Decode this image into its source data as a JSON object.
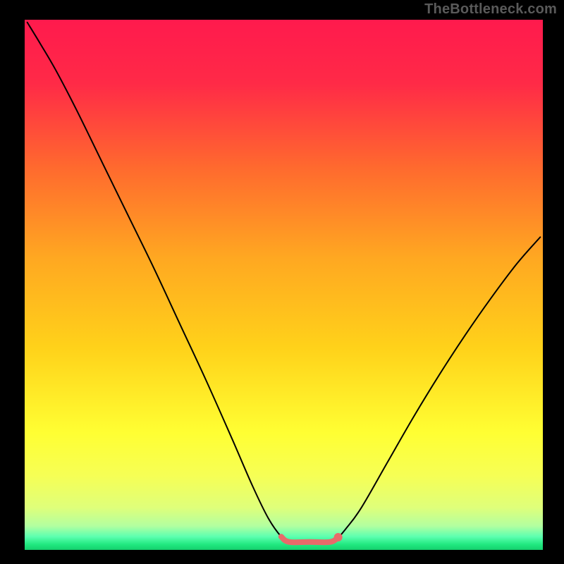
{
  "watermark": "TheBottleneck.com",
  "chart_data": {
    "type": "line",
    "title": "",
    "xlabel": "",
    "ylabel": "",
    "xlim": [
      0,
      100
    ],
    "ylim": [
      0,
      100
    ],
    "background_gradient": {
      "stops": [
        {
          "offset": 0.0,
          "color": "#ff1a4d"
        },
        {
          "offset": 0.12,
          "color": "#ff2a47"
        },
        {
          "offset": 0.28,
          "color": "#ff6a2e"
        },
        {
          "offset": 0.45,
          "color": "#ffa821"
        },
        {
          "offset": 0.62,
          "color": "#ffd21a"
        },
        {
          "offset": 0.78,
          "color": "#ffff33"
        },
        {
          "offset": 0.86,
          "color": "#f6ff55"
        },
        {
          "offset": 0.92,
          "color": "#dfff7a"
        },
        {
          "offset": 0.955,
          "color": "#b2ffa0"
        },
        {
          "offset": 0.975,
          "color": "#5cffb0"
        },
        {
          "offset": 0.99,
          "color": "#20e87f"
        },
        {
          "offset": 1.0,
          "color": "#15cf6d"
        }
      ]
    },
    "series": [
      {
        "name": "bottleneck-curve",
        "color": "#000000",
        "stroke_width": 2,
        "data": [
          {
            "x": 0.5,
            "y": 99.5
          },
          {
            "x": 3,
            "y": 95.5
          },
          {
            "x": 6,
            "y": 90.5
          },
          {
            "x": 10,
            "y": 83.0
          },
          {
            "x": 15,
            "y": 73.0
          },
          {
            "x": 20,
            "y": 63.0
          },
          {
            "x": 25,
            "y": 53.0
          },
          {
            "x": 30,
            "y": 42.5
          },
          {
            "x": 35,
            "y": 32.0
          },
          {
            "x": 40,
            "y": 21.0
          },
          {
            "x": 44,
            "y": 12.0
          },
          {
            "x": 47,
            "y": 6.0
          },
          {
            "x": 49.5,
            "y": 2.5
          },
          {
            "x": 51,
            "y": 1.5
          },
          {
            "x": 55,
            "y": 1.5
          },
          {
            "x": 59,
            "y": 1.5
          },
          {
            "x": 60.5,
            "y": 2.4
          },
          {
            "x": 62,
            "y": 4.0
          },
          {
            "x": 65,
            "y": 8.0
          },
          {
            "x": 70,
            "y": 16.5
          },
          {
            "x": 75,
            "y": 25.0
          },
          {
            "x": 80,
            "y": 33.0
          },
          {
            "x": 85,
            "y": 40.5
          },
          {
            "x": 90,
            "y": 47.5
          },
          {
            "x": 95,
            "y": 54.0
          },
          {
            "x": 99.5,
            "y": 59.0
          }
        ]
      },
      {
        "name": "optimal-zone-highlight",
        "color": "#e86a6a",
        "stroke_width": 8,
        "data": [
          {
            "x": 49.5,
            "y": 2.5
          },
          {
            "x": 51,
            "y": 1.5
          },
          {
            "x": 55,
            "y": 1.5
          },
          {
            "x": 59,
            "y": 1.5
          },
          {
            "x": 60.5,
            "y": 2.4
          }
        ]
      }
    ],
    "markers": [
      {
        "name": "endpoint-dot",
        "x": 60.5,
        "y": 2.4,
        "r": 6,
        "color": "#e86a6a"
      }
    ]
  }
}
